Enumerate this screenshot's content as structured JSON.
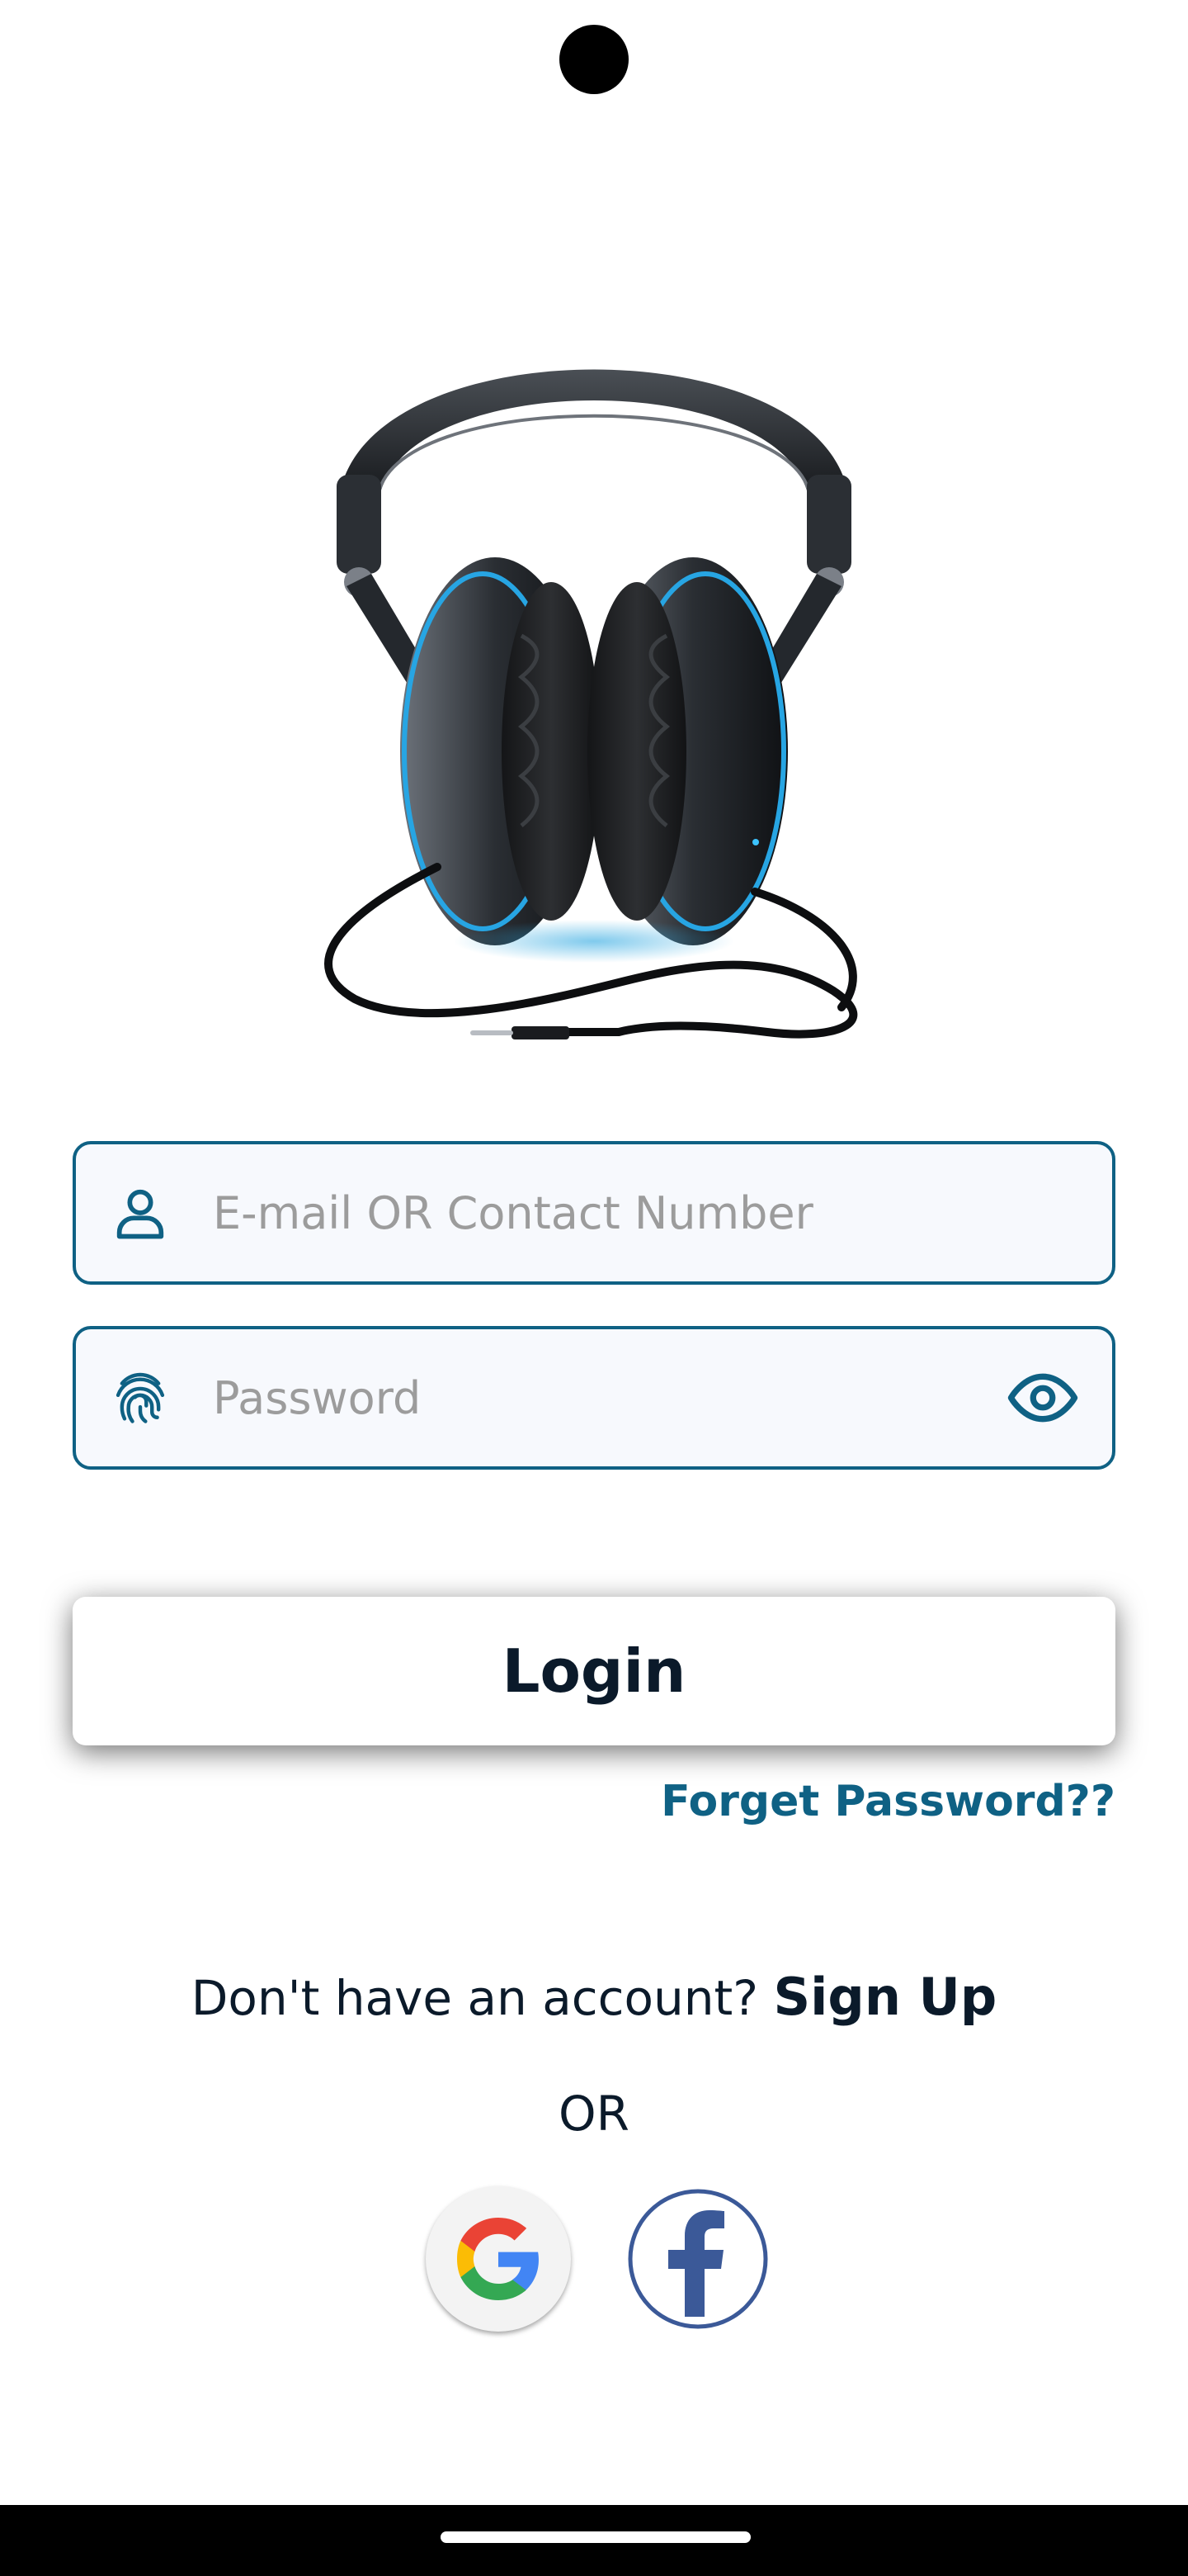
{
  "login_form": {
    "email_placeholder": "E-mail OR Contact Number",
    "email_value": "",
    "password_placeholder": "Password",
    "password_value": "",
    "login_label": "Login",
    "forgot_label": "Forget Password??"
  },
  "signup": {
    "prompt": "Don't have an account? ",
    "link_label": "Sign Up"
  },
  "divider_text": "OR",
  "social": {
    "google_icon": "google-icon",
    "facebook_icon": "facebook-icon"
  },
  "hero_image": "headphones-illustration",
  "colors": {
    "accent": "#0f6184",
    "field_background": "#f7f9fd",
    "text_dark": "#0b1a2a",
    "facebook_blue": "#3b5998"
  }
}
